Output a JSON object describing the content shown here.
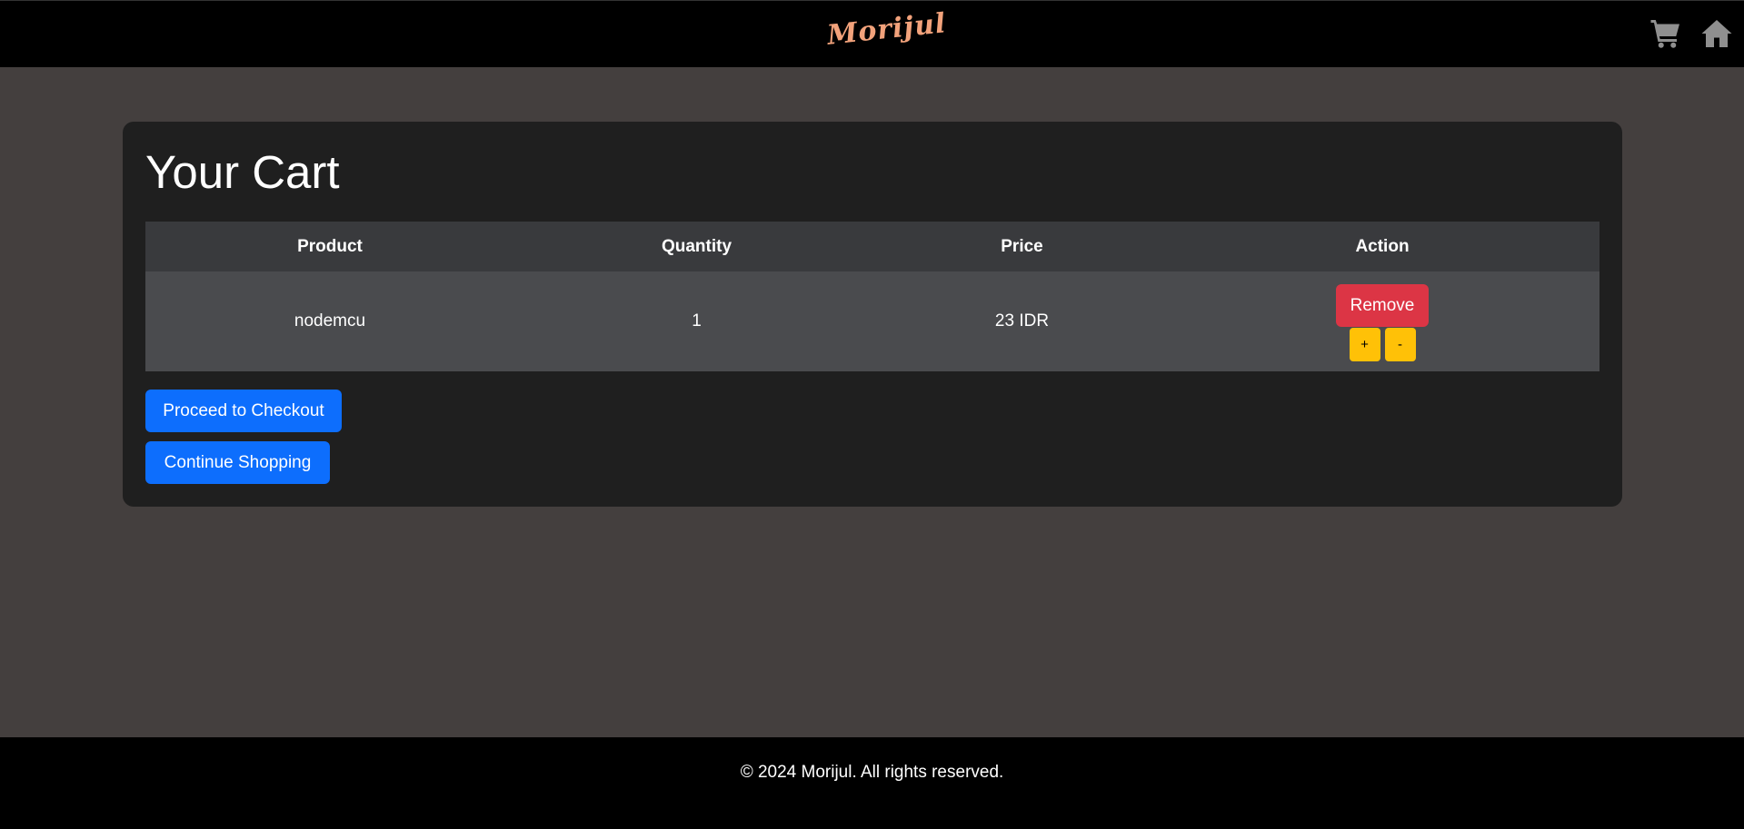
{
  "navbar": {
    "brand": "Morijul",
    "icons": [
      "cart-icon",
      "home-icon"
    ]
  },
  "cart": {
    "title": "Your Cart",
    "columns": [
      "Product",
      "Quantity",
      "Price",
      "Action"
    ],
    "rows": [
      {
        "product": "nodemcu",
        "quantity": "1",
        "price": "23 IDR",
        "remove_label": "Remove",
        "plus_label": "+",
        "minus_label": "-"
      }
    ],
    "checkout_label": "Proceed to Checkout",
    "continue_label": "Continue Shopping"
  },
  "footer": {
    "text": "© 2024 Morijul. All rights reserved."
  },
  "colors": {
    "background": "#443f3e",
    "card": "#1f1f1f",
    "primary": "#0d6efd",
    "danger": "#dc3545",
    "warning": "#ffc107",
    "brand": "#f2a27b"
  }
}
